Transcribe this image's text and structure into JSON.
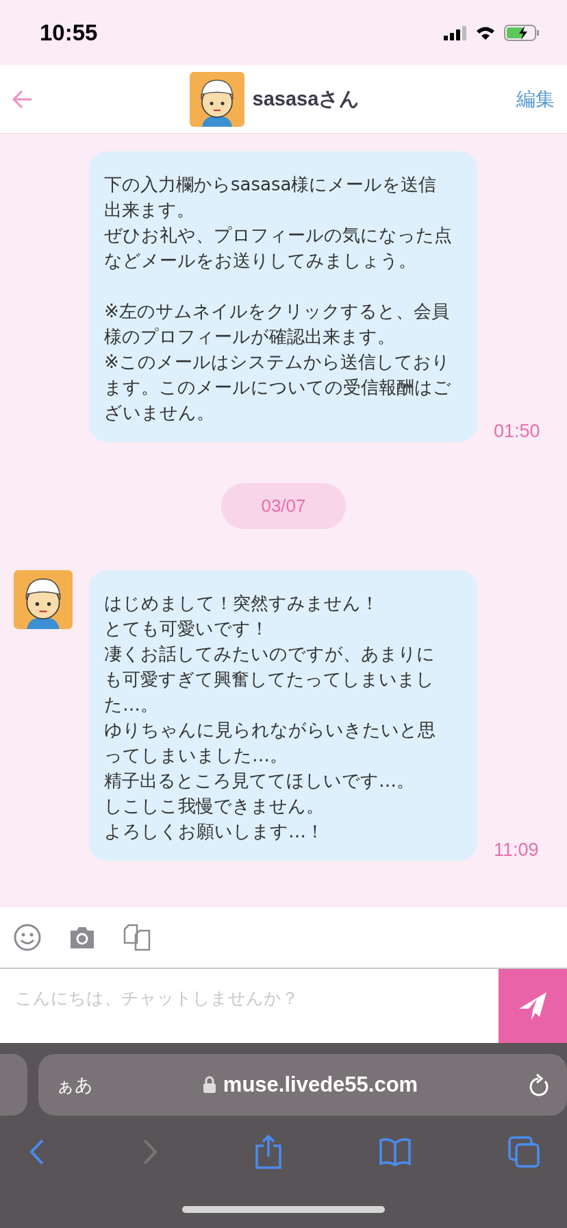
{
  "status_bar": {
    "time": "10:55"
  },
  "header": {
    "title": "sasasaさん",
    "edit": "編集"
  },
  "messages": [
    {
      "kind": "message",
      "avatar": false,
      "paragraphs": [
        {
          "lines": [
            "下の入力欄からsasasa様にメールを送信出来ます。",
            "ぜひお礼や、プロフィールの気になった点などメールをお送りしてみましょう。"
          ]
        },
        {
          "lines": [
            "※左のサムネイルをクリックすると、会員様のプロフィールが確認出来ます。",
            "※このメールはシステムから送信しております。このメールについての受信報酬はございません。"
          ]
        }
      ],
      "time": "01:50"
    },
    {
      "kind": "date",
      "text": "03/07"
    },
    {
      "kind": "message",
      "avatar": true,
      "paragraphs": [
        {
          "lines": [
            "はじめまして！突然すみません！",
            "とても可愛いです！",
            "凄くお話してみたいのですが、あまりにも可愛すぎて興奮してたってしまいました…。",
            "ゆりちゃんに見られながらいきたいと思ってしまいました…。",
            "精子出るところ見ててほしいです…。",
            "しこしこ我慢できません。",
            "よろしくお願いします…！"
          ]
        }
      ],
      "time": "11:09"
    }
  ],
  "composer": {
    "placeholder": "こんにちは、チャットしませんか？"
  },
  "browser": {
    "text_size": "ぁあ",
    "url": "muse.livede55.com"
  }
}
